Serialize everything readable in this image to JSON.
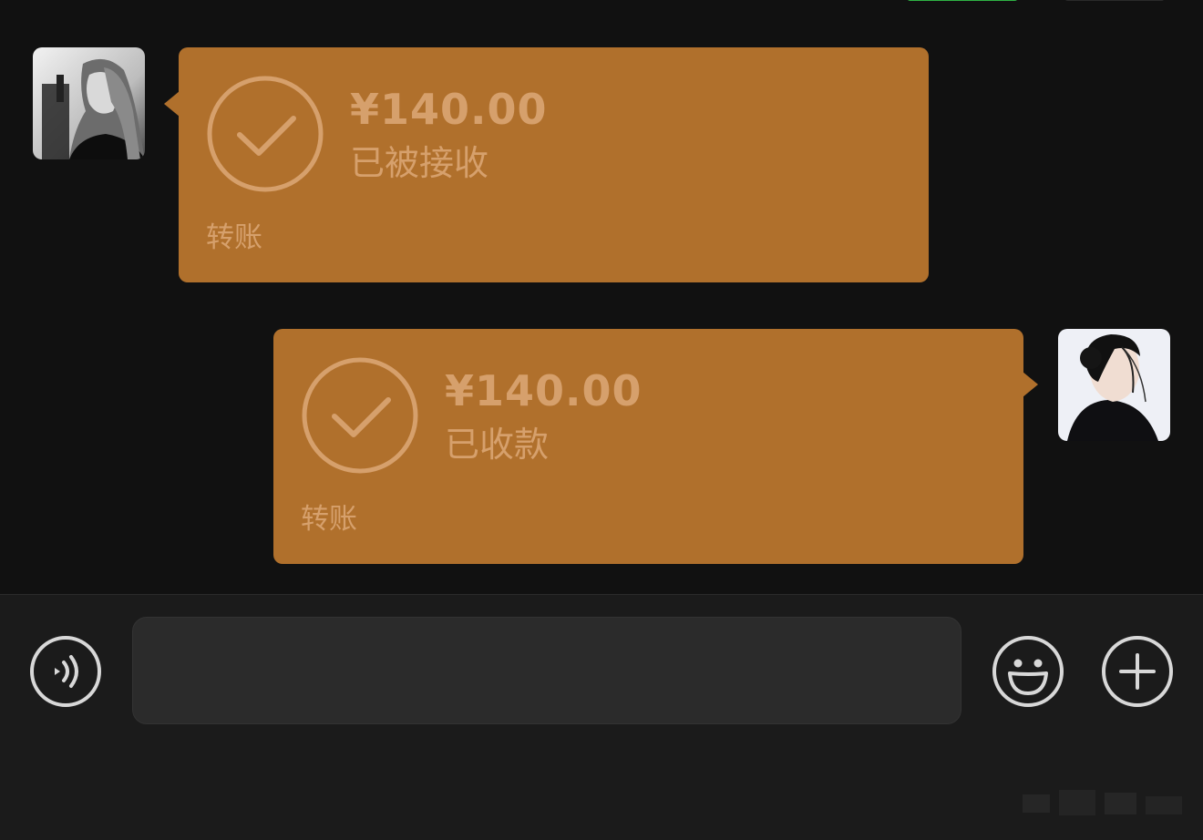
{
  "messages": [
    {
      "side": "left",
      "amount": "¥140.00",
      "status": "已被接收",
      "label": "转账",
      "avatar_icon": "avatar-monochrome-photo"
    },
    {
      "side": "right",
      "amount": "¥140.00",
      "status": "已收款",
      "label": "转账",
      "avatar_icon": "avatar-portrait-photo"
    }
  ],
  "colors": {
    "background": "#111111",
    "bubble": "#b0702c",
    "bubble_text": "#d6a06c",
    "input_bar": "#1b1b1b",
    "input_field": "#2b2b2b",
    "icon_stroke": "#d8d8d8"
  },
  "input_bar": {
    "voice_icon": "voice-icon",
    "text_value": "",
    "emoji_icon": "emoji-icon",
    "plus_icon": "plus-icon"
  }
}
